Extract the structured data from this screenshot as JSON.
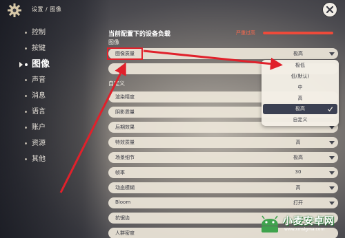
{
  "header": {
    "breadcrumb": "设置 / 图像",
    "settings_icon": "gear-icon",
    "close_icon": "close-icon"
  },
  "sidebar": {
    "items": [
      {
        "label": "控制",
        "active": false
      },
      {
        "label": "按键",
        "active": false
      },
      {
        "label": "图像",
        "active": true
      },
      {
        "label": "声音",
        "active": false
      },
      {
        "label": "消息",
        "active": false
      },
      {
        "label": "语言",
        "active": false
      },
      {
        "label": "账户",
        "active": false
      },
      {
        "label": "资源",
        "active": false
      },
      {
        "label": "其他",
        "active": false
      }
    ]
  },
  "load": {
    "title": "当前配置下的设备负载",
    "status": "严重过高",
    "level_percent": 100,
    "color": "#ee4a3a"
  },
  "section_image": {
    "title": "图像"
  },
  "rows_top": [
    {
      "label": "图像质量",
      "value": "极高"
    },
    {
      "label": "",
      "value": ""
    }
  ],
  "section_custom": {
    "title": "自定义"
  },
  "rows_custom": [
    {
      "label": "渲染精度",
      "value": ""
    },
    {
      "label": "阴影质量",
      "value": ""
    },
    {
      "label": "后期效果",
      "value": ""
    },
    {
      "label": "特效质量",
      "value": "高"
    },
    {
      "label": "场景细节",
      "value": "极高"
    },
    {
      "label": "帧率",
      "value": "30"
    },
    {
      "label": "动态模糊",
      "value": "高"
    },
    {
      "label": "Bloom",
      "value": "打开"
    },
    {
      "label": "抗锯齿",
      "value": ""
    },
    {
      "label": "人群密度",
      "value": ""
    }
  ],
  "dropdown": {
    "options": [
      {
        "label": "极低",
        "selected": false
      },
      {
        "label": "低(默认)",
        "selected": false
      },
      {
        "label": "中",
        "selected": false
      },
      {
        "label": "高",
        "selected": false
      },
      {
        "label": "极高",
        "selected": true
      },
      {
        "label": "自定义",
        "selected": false
      }
    ]
  },
  "annotation_color": "#e0212b",
  "watermark": {
    "name": "小麦安卓网",
    "url": "www.xmsigma.com"
  }
}
